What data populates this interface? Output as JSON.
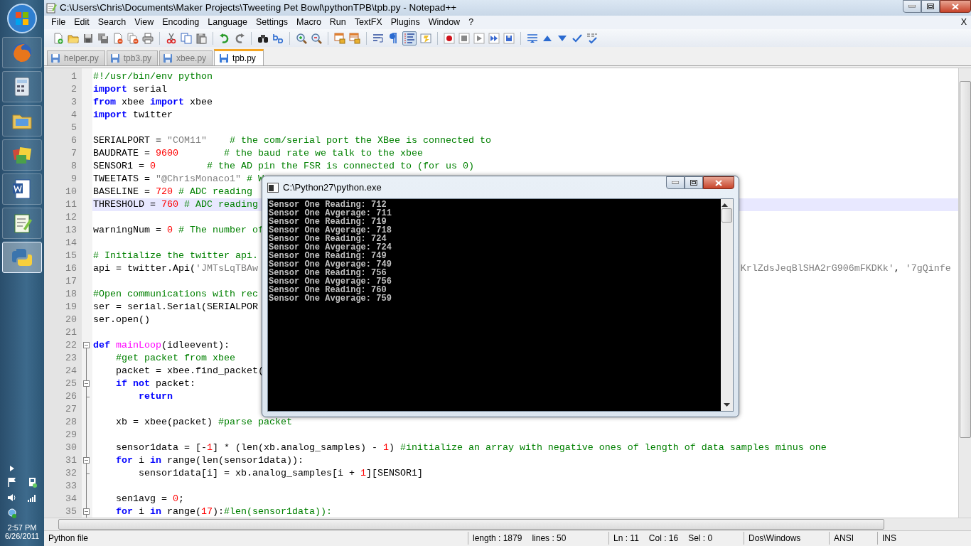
{
  "taskbar": {
    "buttons": [
      {
        "selected": false
      },
      {
        "selected": false
      },
      {
        "selected": false
      },
      {
        "selected": false
      },
      {
        "selected": false
      },
      {
        "selected": false
      },
      {
        "selected": true
      }
    ],
    "time": "2:57 PM",
    "date": "6/26/2011"
  },
  "window": {
    "title": "C:\\Users\\Chris\\Documents\\Maker Projects\\Tweeting Pet Bowl\\pythonTPB\\tpb.py - Notepad++"
  },
  "menu": {
    "items": [
      "File",
      "Edit",
      "Search",
      "View",
      "Encoding",
      "Language",
      "Settings",
      "Macro",
      "Run",
      "TextFX",
      "Plugins",
      "Window",
      "?"
    ],
    "close_document": "X"
  },
  "toolbar": {
    "indent_guides_on": true
  },
  "tabs": [
    {
      "label": "helper.py",
      "selected": false
    },
    {
      "label": "tpb3.py",
      "selected": false
    },
    {
      "label": "xbee.py",
      "selected": false
    },
    {
      "label": "tpb.py",
      "selected": true
    }
  ],
  "editor": {
    "lines": [
      {
        "number": "1",
        "current": false,
        "tokens": [
          {
            "text": "#!/usr/bin/env python",
            "kind": "comment"
          }
        ]
      },
      {
        "number": "2",
        "current": false,
        "tokens": [
          {
            "text": "import",
            "kind": "keyword"
          },
          {
            "text": " serial",
            "kind": "plain"
          }
        ]
      },
      {
        "number": "3",
        "current": false,
        "tokens": [
          {
            "text": "from",
            "kind": "keyword"
          },
          {
            "text": " xbee ",
            "kind": "plain"
          },
          {
            "text": "import",
            "kind": "keyword"
          },
          {
            "text": " xbee",
            "kind": "plain"
          }
        ]
      },
      {
        "number": "4",
        "current": false,
        "tokens": [
          {
            "text": "import",
            "kind": "keyword"
          },
          {
            "text": " twitter",
            "kind": "plain"
          }
        ]
      },
      {
        "number": "5",
        "current": false
      },
      {
        "number": "6",
        "current": false,
        "tokens": [
          {
            "text": "SERIALPORT = ",
            "kind": "plain"
          },
          {
            "text": "\"COM11\"",
            "kind": "string"
          },
          {
            "text": "    # the com/serial port the XBee is connected to",
            "kind": "comment"
          }
        ]
      },
      {
        "number": "7",
        "current": false,
        "tokens": [
          {
            "text": "BAUDRATE = ",
            "kind": "plain"
          },
          {
            "text": "9600",
            "kind": "number"
          },
          {
            "text": "        # the baud rate we talk to the xbee",
            "kind": "comment"
          }
        ]
      },
      {
        "number": "8",
        "current": false,
        "tokens": [
          {
            "text": "SENSOR1 = ",
            "kind": "plain"
          },
          {
            "text": "0",
            "kind": "number"
          },
          {
            "text": "         # the AD pin the FSR is connected to (for us 0)",
            "kind": "comment"
          }
        ]
      },
      {
        "number": "9",
        "current": false,
        "tokens": [
          {
            "text": "TWEETATS = ",
            "kind": "plain"
          },
          {
            "text": "\"@ChrisMonaco1\"",
            "kind": "string"
          },
          {
            "text": " # W",
            "kind": "comment"
          }
        ]
      },
      {
        "number": "10",
        "current": false,
        "tokens": [
          {
            "text": "BASELINE = ",
            "kind": "plain"
          },
          {
            "text": "720",
            "kind": "number"
          },
          {
            "text": " # ADC reading",
            "kind": "comment"
          }
        ]
      },
      {
        "number": "11",
        "current": true,
        "tokens": [
          {
            "text": "THRESHOLD = ",
            "kind": "plain"
          },
          {
            "text": "760",
            "kind": "number"
          },
          {
            "text": " # ADC reading",
            "kind": "comment"
          }
        ]
      },
      {
        "number": "12",
        "current": false
      },
      {
        "number": "13",
        "current": false,
        "tokens": [
          {
            "text": "warningNum = ",
            "kind": "plain"
          },
          {
            "text": "0",
            "kind": "number"
          },
          {
            "text": " # The number of",
            "kind": "comment"
          }
        ]
      },
      {
        "number": "14",
        "current": false
      },
      {
        "number": "15",
        "current": false,
        "tokens": [
          {
            "text": "# Initialize the twitter api.",
            "kind": "comment"
          }
        ]
      },
      {
        "number": "16",
        "current": false,
        "tokens": [
          {
            "text": "api = twitter.Api(",
            "kind": "plain"
          },
          {
            "text": "'JMTsLqTBAw",
            "kind": "string"
          }
        ],
        "tail": [
          {
            "text": "KrlZdsJeqBlSHA2rG906mFKDKk'",
            "kind": "string"
          },
          {
            "text": ", ",
            "kind": "plain"
          },
          {
            "text": "'7gQinfe",
            "kind": "string"
          }
        ]
      },
      {
        "number": "17",
        "current": false
      },
      {
        "number": "18",
        "current": false,
        "tokens": [
          {
            "text": "#Open communications with rec",
            "kind": "comment"
          }
        ]
      },
      {
        "number": "19",
        "current": false,
        "tokens": [
          {
            "text": "ser = serial.Serial(SERIALPOR",
            "kind": "plain"
          }
        ]
      },
      {
        "number": "20",
        "current": false,
        "tokens": [
          {
            "text": "ser.open()",
            "kind": "plain"
          }
        ]
      },
      {
        "number": "21",
        "current": false
      },
      {
        "number": "22",
        "current": false,
        "kind": "header",
        "tokens": [
          {
            "text": "def",
            "kind": "keyword"
          },
          {
            "text": " mainLoop",
            "kind": "function"
          },
          {
            "text": "(idleevent):",
            "kind": "plain"
          }
        ]
      },
      {
        "number": "23",
        "current": false,
        "kind": "body",
        "tokens": [
          {
            "text": "    #get packet from xbee",
            "kind": "comment"
          }
        ]
      },
      {
        "number": "24",
        "current": false,
        "kind": "body",
        "tokens": [
          {
            "text": "    packet = xbee.find_packet(",
            "kind": "plain"
          }
        ]
      },
      {
        "number": "25",
        "current": false,
        "kind": "header",
        "tokens": [
          {
            "text": "    if not",
            "kind": "keyword"
          },
          {
            "text": " packet:",
            "kind": "plain"
          }
        ]
      },
      {
        "number": "26",
        "current": false,
        "kind": "end",
        "tokens": [
          {
            "text": "        return",
            "kind": "keyword"
          }
        ]
      },
      {
        "number": "27",
        "current": false,
        "kind": "body"
      },
      {
        "number": "28",
        "current": false,
        "kind": "body",
        "tokens": [
          {
            "text": "    xb = xbee(packet) ",
            "kind": "plain"
          },
          {
            "text": "#parse packet",
            "kind": "comment"
          }
        ]
      },
      {
        "number": "29",
        "current": false,
        "kind": "body"
      },
      {
        "number": "30",
        "current": false,
        "kind": "body",
        "tokens": [
          {
            "text": "    sensor1data = [-",
            "kind": "plain"
          },
          {
            "text": "1",
            "kind": "number"
          },
          {
            "text": "] * (len(xb.analog_samples) - ",
            "kind": "plain"
          },
          {
            "text": "1",
            "kind": "number"
          },
          {
            "text": ") ",
            "kind": "plain"
          },
          {
            "text": "#initialize an array with negative ones of length of data samples minus one",
            "kind": "comment"
          }
        ]
      },
      {
        "number": "31",
        "current": false,
        "kind": "header",
        "tokens": [
          {
            "text": "    for",
            "kind": "keyword"
          },
          {
            "text": " i ",
            "kind": "plain"
          },
          {
            "text": "in",
            "kind": "keyword"
          },
          {
            "text": " range(len(sensor1data)):",
            "kind": "plain"
          }
        ]
      },
      {
        "number": "32",
        "current": false,
        "kind": "end",
        "tokens": [
          {
            "text": "        sensor1data[i] = xb.analog_samples[i + ",
            "kind": "plain"
          },
          {
            "text": "1",
            "kind": "number"
          },
          {
            "text": "][SENSOR1]",
            "kind": "plain"
          }
        ]
      },
      {
        "number": "33",
        "current": false,
        "kind": "body"
      },
      {
        "number": "34",
        "current": false,
        "kind": "body",
        "tokens": [
          {
            "text": "    sen1avg = ",
            "kind": "plain"
          },
          {
            "text": "0",
            "kind": "number"
          },
          {
            "text": ";",
            "kind": "plain"
          }
        ]
      },
      {
        "number": "35",
        "current": false,
        "kind": "header",
        "tokens": [
          {
            "text": "    for",
            "kind": "keyword"
          },
          {
            "text": " i ",
            "kind": "plain"
          },
          {
            "text": "in",
            "kind": "keyword"
          },
          {
            "text": " range(",
            "kind": "plain"
          },
          {
            "text": "17",
            "kind": "number"
          },
          {
            "text": "):",
            "kind": "plain"
          },
          {
            "text": "#len(sensor1data)):",
            "kind": "comment"
          }
        ]
      }
    ]
  },
  "status_bar": {
    "file_type": "Python file",
    "length": "length : 1879",
    "lines": "lines : 50",
    "ln": "Ln : 11",
    "col": "Col : 16",
    "sel": "Sel : 0",
    "eol": "Dos\\Windows",
    "encoding": "ANSI",
    "mode": "INS"
  },
  "console": {
    "title": "C:\\Python27\\python.exe",
    "lines": [
      "Sensor One Reading: 712",
      "Sensor One Avgerage: 711",
      "Sensor One Reading: 719",
      "Sensor One Avgerage: 718",
      "Sensor One Reading: 724",
      "Sensor One Avgerage: 724",
      "Sensor One Reading: 749",
      "Sensor One Avgerage: 749",
      "Sensor One Reading: 756",
      "Sensor One Avgerage: 756",
      "Sensor One Reading: 760",
      "Sensor One Avgerage: 759"
    ]
  }
}
